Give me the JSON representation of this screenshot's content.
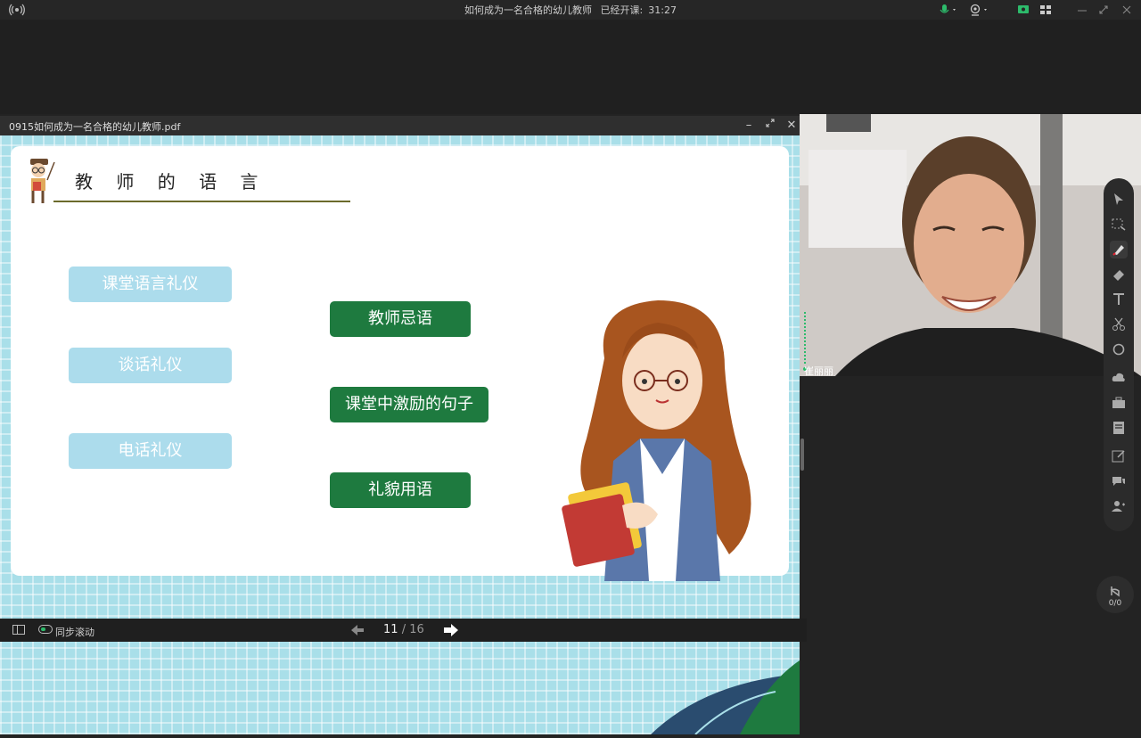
{
  "topbar": {
    "title": "如何成为一名合格的幼儿教师",
    "class_label": "已经开课:",
    "class_time": "31:27"
  },
  "pdf": {
    "filename": "0915如何成为一名合格的幼儿教师.pdf",
    "slide_title": "教 师 的 语 言",
    "left_items": [
      "课堂语言礼仪",
      "谈话礼仪",
      "电话礼仪"
    ],
    "right_items": [
      "教师忌语",
      "课堂中激励的句子",
      "礼貌用语"
    ],
    "current_page": "11",
    "separator": "/",
    "total_pages": "16",
    "sync_label": "同步滚动"
  },
  "video": {
    "participant_name": "崔丽丽"
  },
  "hand_raise": {
    "count": "0/0"
  },
  "colors": {
    "accent_green": "#1e7a3f",
    "light_pill": "#acdcec",
    "slide_bg": "#a9dfe9"
  },
  "icons": [
    "broadcast-icon",
    "mic-icon",
    "camera-icon",
    "screen-share-icon",
    "grid-icon",
    "minimize-icon",
    "restore-icon",
    "close-icon",
    "cursor-icon",
    "select-icon",
    "pen-icon",
    "eraser-icon",
    "text-icon",
    "scissors-icon",
    "shape-icon",
    "cloud-icon",
    "toolbox-icon",
    "notes-icon",
    "edit-icon",
    "chat-icon",
    "users-icon",
    "hand-icon"
  ]
}
